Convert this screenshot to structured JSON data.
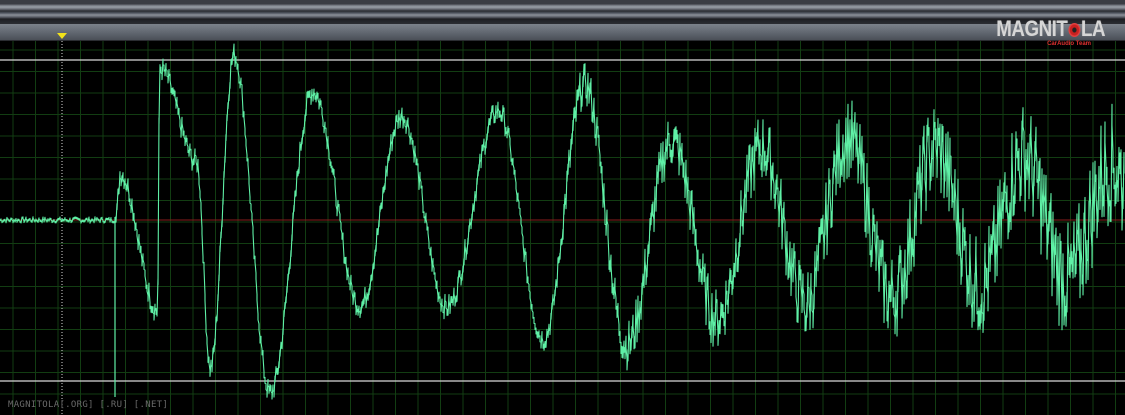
{
  "editor": {
    "background_color": "#000000",
    "grid_color": "#123d12",
    "waveform_color": "#5ff0a6",
    "center_line_color": "#8a1c1c",
    "clip_line_color": "#d9d9d9",
    "playhead_color": "#f2e21a"
  },
  "logo": {
    "main_left": "MAGNIT",
    "main_right": "LA",
    "sub": "CarAudio Team"
  },
  "watermark": {
    "text": "MAGNITOLA[.ORG] [.RU] [.NET]"
  },
  "waveform": {
    "silence_until_fraction": 0.103,
    "envelope_peaks": [
      {
        "t": 0.107,
        "level": 0.28
      },
      {
        "t": 0.14,
        "level": -0.55
      },
      {
        "t": 0.142,
        "level": 0.92
      },
      {
        "t": 0.175,
        "level": 0.35
      },
      {
        "t": 0.187,
        "level": -0.9
      },
      {
        "t": 0.208,
        "level": 1.0
      },
      {
        "t": 0.24,
        "level": -1.05
      },
      {
        "t": 0.278,
        "level": 0.78
      },
      {
        "t": 0.32,
        "level": -0.52
      },
      {
        "t": 0.357,
        "level": 0.63
      },
      {
        "t": 0.397,
        "level": -0.53
      },
      {
        "t": 0.443,
        "level": 0.66
      },
      {
        "t": 0.483,
        "level": -0.72
      },
      {
        "t": 0.52,
        "level": 0.82
      },
      {
        "t": 0.557,
        "level": -0.76
      },
      {
        "t": 0.597,
        "level": 0.48
      },
      {
        "t": 0.637,
        "level": -0.6
      },
      {
        "t": 0.677,
        "level": 0.44
      },
      {
        "t": 0.715,
        "level": -0.48
      }
    ]
  }
}
